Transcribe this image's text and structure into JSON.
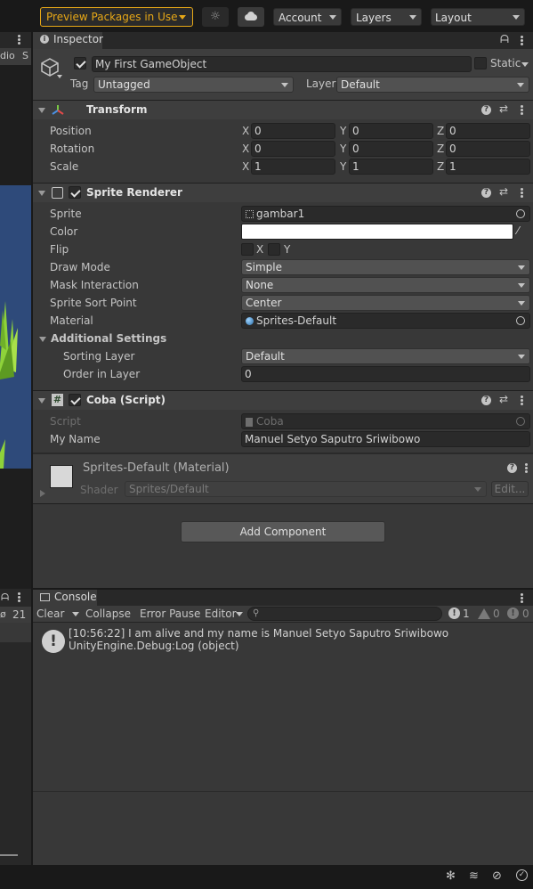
{
  "toolbar": {
    "preview_packages": "Preview Packages in Use",
    "account": "Account",
    "layers": "Layers",
    "layout": "Layout"
  },
  "left_panel": {
    "tab_fragment_1": "dio",
    "tab_fragment_2": "S",
    "count": "21"
  },
  "inspector": {
    "tab_label": "Inspector",
    "gameobject_name": "My First GameObject",
    "static_label": "Static",
    "tag_label": "Tag",
    "tag_value": "Untagged",
    "layer_label": "Layer",
    "layer_value": "Default",
    "transform": {
      "title": "Transform",
      "position_label": "Position",
      "rotation_label": "Rotation",
      "scale_label": "Scale",
      "x": "X",
      "y": "Y",
      "z": "Z",
      "position": [
        "0",
        "0",
        "0"
      ],
      "rotation": [
        "0",
        "0",
        "0"
      ],
      "scale": [
        "1",
        "1",
        "1"
      ]
    },
    "sprite_renderer": {
      "title": "Sprite Renderer",
      "sprite_label": "Sprite",
      "sprite_value": "gambar1",
      "color_label": "Color",
      "flip_label": "Flip",
      "flip_x": "X",
      "flip_y": "Y",
      "draw_mode_label": "Draw Mode",
      "draw_mode_value": "Simple",
      "mask_label": "Mask Interaction",
      "mask_value": "None",
      "sort_point_label": "Sprite Sort Point",
      "sort_point_value": "Center",
      "material_label": "Material",
      "material_value": "Sprites-Default",
      "additional_label": "Additional Settings",
      "sorting_layer_label": "Sorting Layer",
      "sorting_layer_value": "Default",
      "order_label": "Order in Layer",
      "order_value": "0"
    },
    "coba_script": {
      "title": "Coba (Script)",
      "script_label": "Script",
      "script_value": "Coba",
      "myname_label": "My Name",
      "myname_value": "Manuel Setyo Saputro Sriwibowo"
    },
    "material": {
      "title": "Sprites-Default (Material)",
      "shader_label": "Shader",
      "shader_value": "Sprites/Default",
      "edit_label": "Edit..."
    },
    "add_component": "Add Component"
  },
  "console": {
    "tab_label": "Console",
    "clear": "Clear",
    "collapse": "Collapse",
    "error_pause": "Error Pause",
    "editor": "Editor",
    "log_count": "1",
    "warn_count": "0",
    "error_count": "0",
    "message_line1": "[10:56:22] I am alive and my name is Manuel Setyo Saputro Sriwibowo",
    "message_line2": "UnityEngine.Debug:Log (object)"
  },
  "colors": {
    "accent_preview": "#e6a717",
    "scene_blue": "#2e4a7a",
    "grass_green": "#8ed23a",
    "background": "#383838"
  }
}
